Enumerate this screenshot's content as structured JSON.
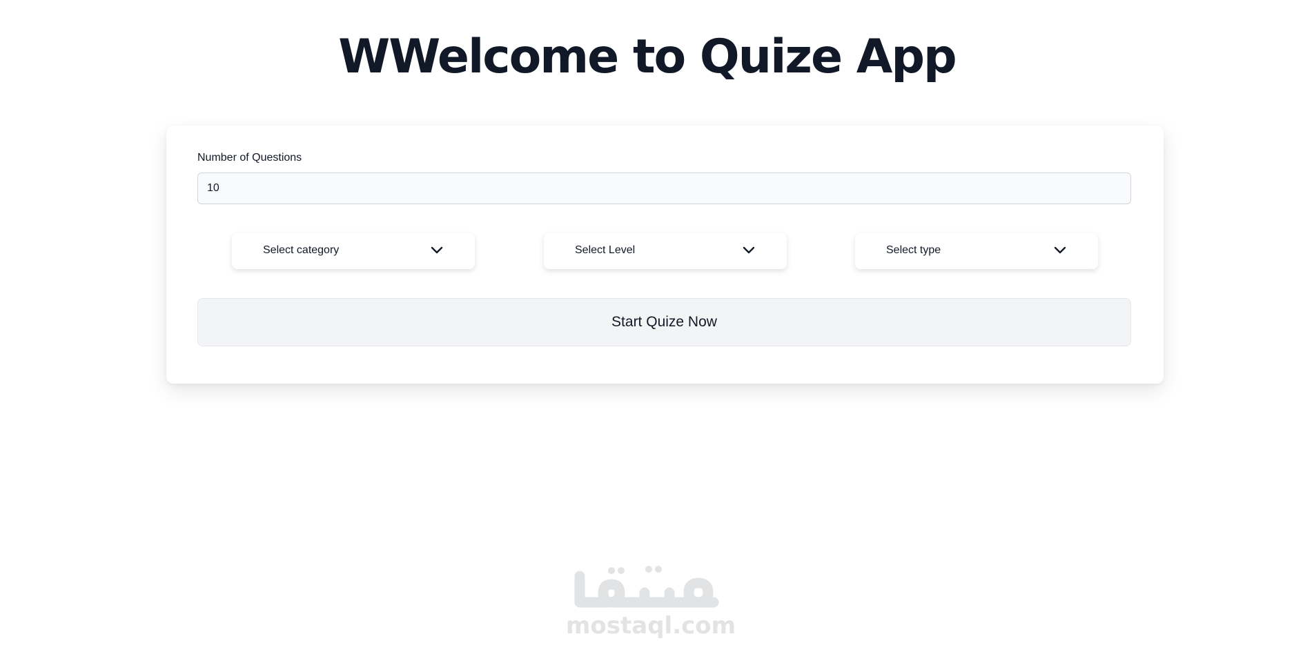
{
  "header": {
    "title": "WWelcome to Quize App"
  },
  "form": {
    "questions_label": "Number of Questions",
    "questions_value": "10",
    "selects": [
      {
        "label": "Select category",
        "icon": "chevron-down-icon"
      },
      {
        "label": "Select Level",
        "icon": "chevron-down-icon"
      },
      {
        "label": "Select type",
        "icon": "chevron-down-icon"
      }
    ],
    "start_label": "Start Quize Now"
  },
  "watermark": {
    "text": "mostaql.com",
    "logo_text": "مستقل"
  },
  "colors": {
    "text": "#111827",
    "input_bg": "#f9fafb",
    "button_bg": "#f3f4f6",
    "watermark": "#e2e3e5"
  }
}
